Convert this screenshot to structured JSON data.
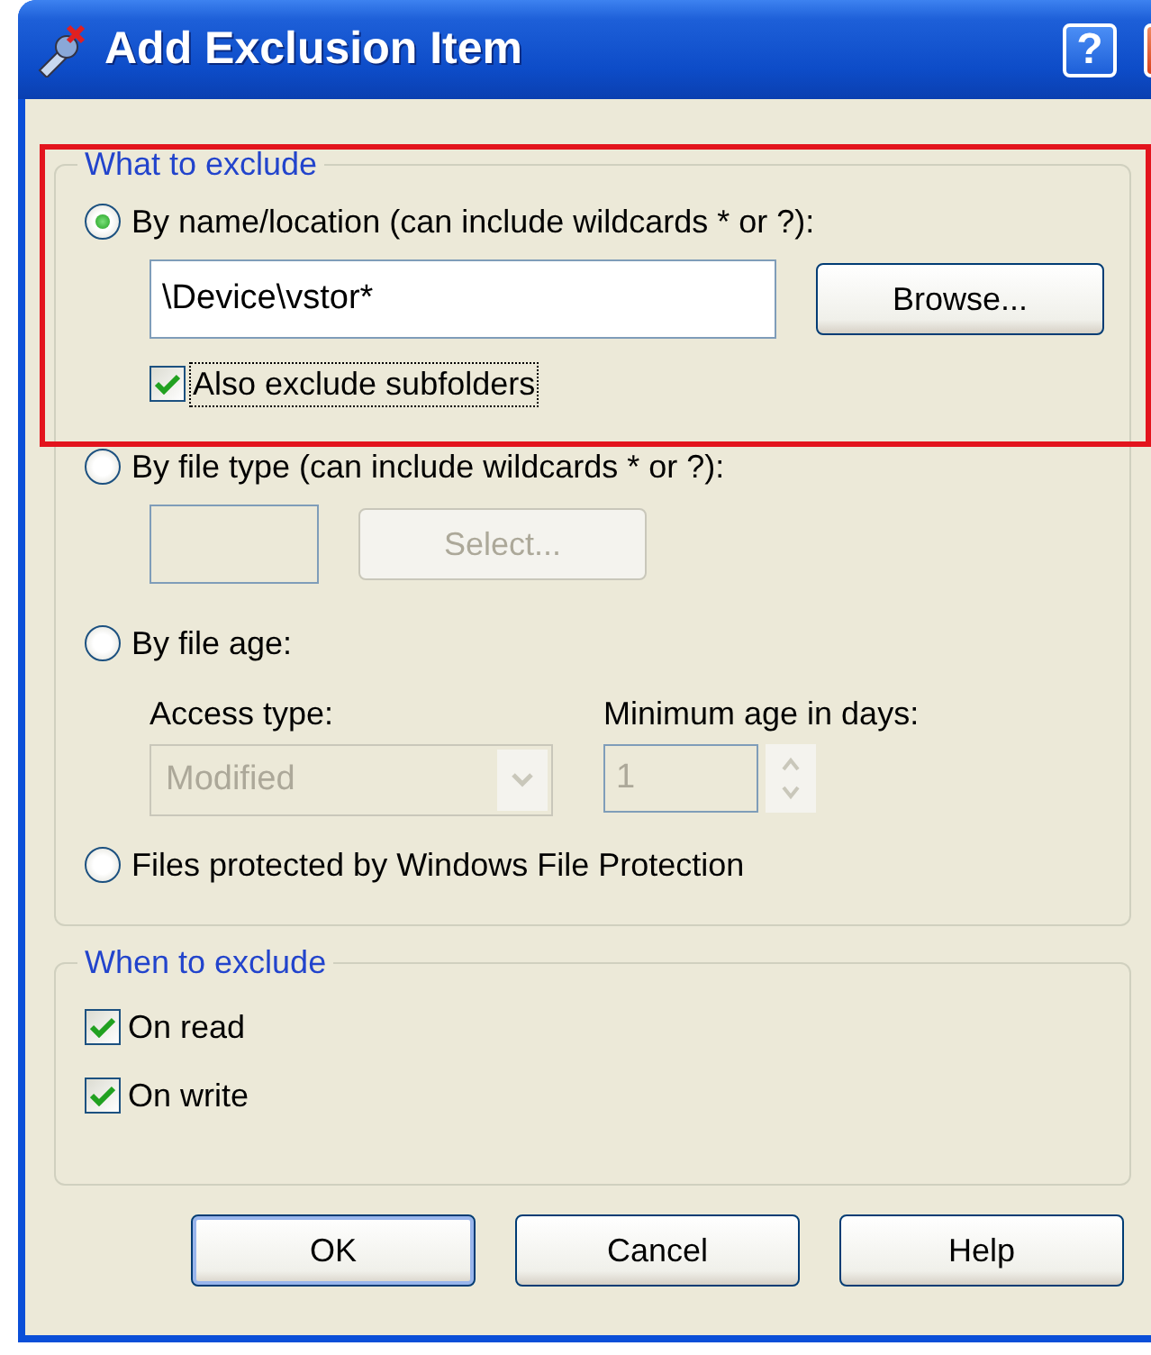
{
  "window": {
    "title": "Add Exclusion Item",
    "title_buttons": [
      {
        "kind": "help",
        "label": "?"
      },
      {
        "kind": "close"
      }
    ]
  },
  "what_to_exclude": {
    "title": "What to exclude",
    "highlighted": true,
    "options": [
      {
        "kind": "name",
        "label": "By name/location (can include wildcards * or ?):",
        "selected": true,
        "value": "\\Device\\vstor*",
        "button": "Browse...",
        "subfolders": {
          "label": "Also exclude subfolders",
          "checked": true,
          "focused": true
        }
      },
      {
        "kind": "type",
        "label": "By file type (can include wildcards * or ?):",
        "selected": false,
        "button": "Select..."
      },
      {
        "kind": "age",
        "label": "By file age:",
        "selected": false,
        "access_label": "Access type:",
        "access_value": "Modified",
        "age_label": "Minimum age in days:",
        "age_value": "1"
      },
      {
        "kind": "wfp",
        "label": "Files protected by Windows File Protection",
        "selected": false
      }
    ]
  },
  "when_to_exclude": {
    "title": "When to exclude",
    "items": [
      {
        "label": "On read",
        "checked": true
      },
      {
        "label": "On write",
        "checked": true
      }
    ]
  },
  "buttons": [
    {
      "label": "OK",
      "default": true
    },
    {
      "label": "Cancel",
      "default": false
    },
    {
      "label": "Help",
      "default": false
    }
  ]
}
